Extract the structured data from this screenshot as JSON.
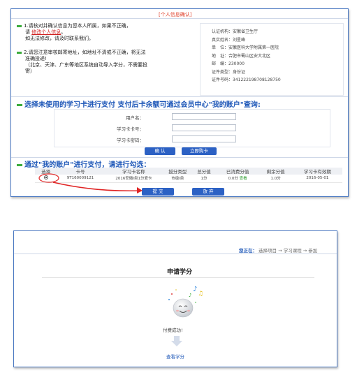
{
  "panel1": {
    "title": "[个人信息确认]",
    "notice1": {
      "line1": "1.请核对并确认信息为您本人所属，如果不正确，",
      "line2_prefix": "请",
      "link": "修改个人信息",
      "line2_suffix": "。",
      "line3": "如无法修改，请及时联系我们。"
    },
    "notice2": {
      "line1": "2.请您注意审核邮寄地址，如地址不清或不正确，将无法",
      "line2": "准确投递!",
      "line3": "（北京、天津、广东等地区系统自动导入学分，不需要投",
      "line4": "寄）"
    },
    "info": [
      "认证机构：安徽省卫生厅",
      "真实姓名：刘星峰",
      "单　位：安徽医科大学附属第一医院",
      "地　址：合肥市蜀山区安大北区",
      "邮　编：230000",
      "证件类型：身份证",
      "证件号码：341222198708128750"
    ],
    "section1": "选择未使用的学习卡进行支付  支付后卡余额可通过会员中心\"我的账户\"查询:",
    "form": {
      "username_label": "用户名：",
      "card_label": "学习卡卡号：",
      "password_label": "学习卡密码："
    },
    "confirm_btn": "确 认",
    "buy_btn": "立即购卡",
    "section2": "通过\"我的账户\"进行支付，请进行勾选：",
    "table": {
      "headers": [
        "选择",
        "卡号",
        "学习卡名称",
        "授分类型",
        "总分值",
        "已消费分值",
        "剩余分值",
        "学习卡有效期"
      ],
      "row": [
        "",
        "9T160009121",
        "2016安徽I类1分爱卡",
        "市级I类",
        "1分",
        "0.0分",
        "查看",
        "1.0分",
        "2016-05-01"
      ]
    },
    "submit_btn": "提 交",
    "abandon_btn": "放 弃"
  },
  "panel2": {
    "crumb_prefix": "您正在：",
    "crumb_items": [
      "选择项目",
      "→",
      "学习课程",
      "→",
      "参加"
    ],
    "title": "申请学分",
    "success": "付费成功!",
    "view_link": "查看学分"
  },
  "colors": {
    "accent_blue": "#1e57b8",
    "button_blue": "#2c61c4",
    "alert_red": "#d02020",
    "green": "#3cac3c"
  }
}
